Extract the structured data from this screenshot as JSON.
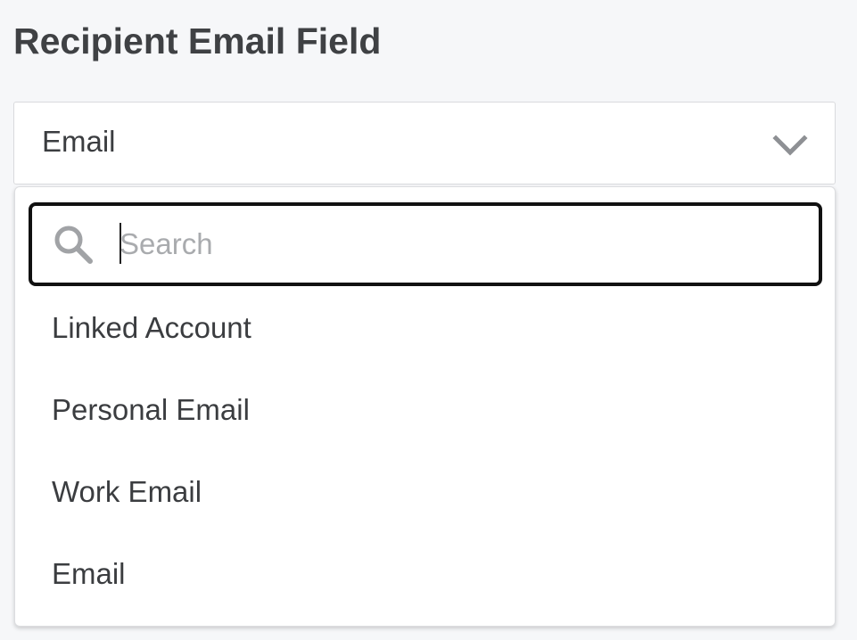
{
  "field": {
    "label": "Recipient Email Field",
    "selected_value": "Email",
    "chevron_icon": "chevron-down-icon"
  },
  "dropdown": {
    "search": {
      "placeholder": "Search",
      "value": "",
      "icon": "search-icon"
    },
    "options": [
      {
        "label": "Linked Account"
      },
      {
        "label": "Personal Email"
      },
      {
        "label": "Work Email"
      },
      {
        "label": "Email"
      }
    ]
  },
  "colors": {
    "page_background": "#f6f7f9",
    "text": "#3b3d40",
    "placeholder": "#a9abae",
    "focus_border": "#111111",
    "icon": "#8e9094"
  }
}
